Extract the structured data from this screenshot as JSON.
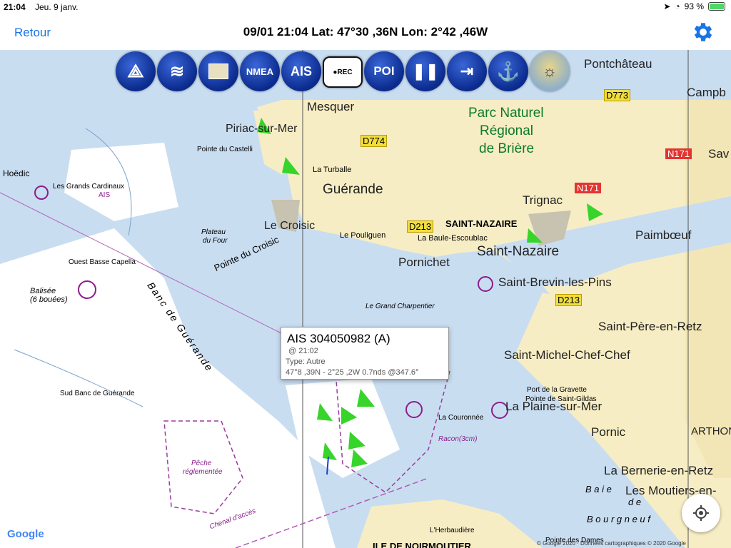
{
  "status": {
    "time": "21:04",
    "date": "Jeu. 9 janv.",
    "battery_pct": "93 %",
    "battery_level": 0.93
  },
  "nav": {
    "back_label": "Retour",
    "title": "09/01 21:04  Lat: 47°30 ,36N Lon: 2°42 ,46W",
    "settings_icon": "gear-icon"
  },
  "toolbar": [
    {
      "name": "compass-tool-button",
      "icon": "divider-compass-icon",
      "label": ""
    },
    {
      "name": "wind-button",
      "icon": "wind-icon",
      "label": ""
    },
    {
      "name": "chart-button",
      "icon": "map-icon",
      "label": ""
    },
    {
      "name": "nmea-button",
      "icon": "nmea-icon",
      "label": "NMEA"
    },
    {
      "name": "ais-button",
      "icon": "ais-icon",
      "label": "AIS"
    },
    {
      "name": "rec-button",
      "icon": "record-icon",
      "label": "REC"
    },
    {
      "name": "poi-button",
      "icon": "poi-icon",
      "label": "POI"
    },
    {
      "name": "pause-button",
      "icon": "pause-icon",
      "label": ""
    },
    {
      "name": "exit-button",
      "icon": "exit-icon",
      "label": ""
    },
    {
      "name": "anchor-button",
      "icon": "anchor-icon",
      "label": ""
    },
    {
      "name": "weather-button",
      "icon": "sea-weather-icon",
      "label": ""
    }
  ],
  "map_labels": {
    "mesquer": "Mesquer",
    "pontchateau": "Pontchâteau",
    "campb": "Campb",
    "parc1": "Parc Naturel",
    "parc2": "Régional",
    "parc3": "de Brière",
    "piriac": "Piriac-sur-Mer",
    "guerande": "Guérande",
    "trignac": "Trignac",
    "sav": "Sav",
    "le_croisic": "Le Croisic",
    "saint_nazaire_caps": "SAINT-NAZAIRE",
    "saint_nazaire": "Saint-Nazaire",
    "paimboeuf": "Paimbœuf",
    "pornichet": "Pornichet",
    "saint_brevin": "Saint-Brevin-les-Pins",
    "saint_pere": "Saint-Père-en-Retz",
    "saint_michel": "Saint-Michel-Chef-Chef",
    "la_plaine": "La Plaine-sur-Mer",
    "pornic": "Pornic",
    "arthon": "ARTHON",
    "la_bernerie": "La Bernerie-en-Retz",
    "les_moutiers": "Les Moutiers-en-",
    "la_baule": "La Baule-Escoublac",
    "le_pouliguen": "Le Pouliguen",
    "la_turballe": "La Turballe",
    "pointe_du_croisic": "Pointe du Croisic",
    "banc": "Banc de Guérande",
    "baie1": "B a i e",
    "baie2": "d e",
    "bourgneuf": "B o u r g n e u f",
    "ile_noirmoutier": "ILE DE NOIRMOUTIER",
    "hoedic": "Hoëdic",
    "grands_cardinaux": "Les Grands Cardinaux",
    "ouest_basse": "Ouest Basse Capella",
    "balisee": "Balisée",
    "bouees": "(6 bouées)",
    "grand_charpentier": "Le Grand Charpentier",
    "la_couronnee": "La Couronnée",
    "port_gravette": "Port de la Gravette",
    "pointe_gildas": "Pointe de Saint-Gildas",
    "peche": "Pêche",
    "reglementee": "réglementée",
    "chenal": "Chenal d'accès",
    "sud_banc": "Sud Banc de Guérande",
    "plateau": "Plateau",
    "du_four": "du Four",
    "pointe_castelli": "Pointe du Castelli",
    "marker_ais": "AIS",
    "racon": "Racon(3cm)",
    "pointe_dames": "Pointe des Dames",
    "lherbaudiere": "L'Herbaudière"
  },
  "roads": {
    "d774": "D774",
    "d773": "D773",
    "d213a": "D213",
    "d213b": "D213",
    "n171a": "N171",
    "n171b": "N171"
  },
  "popup": {
    "title": "AIS 304050982 (A)",
    "time": "@ 21:02",
    "type": "Type: Autre",
    "details": "47°8 ,39N - 2°25 ,2W 0.7nds @347.6°"
  },
  "footer": {
    "google": "Google",
    "copyright": "© Google 2020 · Données cartographiques © 2020 Google"
  },
  "colors": {
    "sea_deep": "#ffffff",
    "sea_shallow": "#c9ddf1",
    "land": "#f7edc4",
    "accent": "#1a73e8",
    "ais_green": "#37d42a",
    "buoy_purple": "#8a1e8c"
  }
}
